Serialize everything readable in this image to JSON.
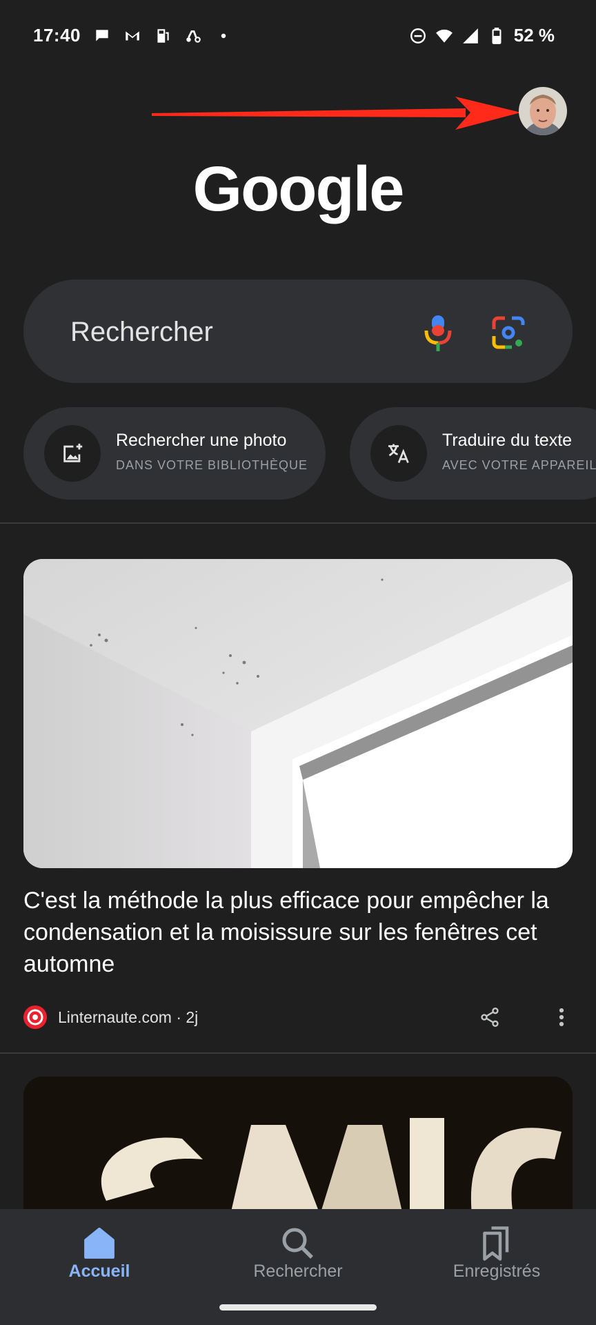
{
  "status_bar": {
    "time": "17:40",
    "battery": "52 %",
    "left_icons": [
      "chat-bubble-icon",
      "gmail-icon",
      "fuel-icon",
      "scooter-icon",
      "dot-icon"
    ],
    "right_icons": [
      "do-not-disturb-icon",
      "wifi-icon",
      "signal-icon",
      "battery-icon"
    ]
  },
  "header": {
    "logo": "Google",
    "avatar_icon": "profile-avatar-icon"
  },
  "search": {
    "placeholder": "Rechercher",
    "mic_icon": "mic-icon",
    "lens_icon": "google-lens-icon"
  },
  "chips": [
    {
      "title": "Rechercher une photo",
      "subtitle": "DANS VOTRE BIBLIOTHÈQUE",
      "icon": "add-photo-icon"
    },
    {
      "title": "Traduire du texte",
      "subtitle": "AVEC VOTRE APPAREIL",
      "icon": "translate-icon"
    }
  ],
  "article": {
    "title": "C'est la méthode la plus efficace pour empêcher la condensation et la moisissure sur les fenêtres cet automne",
    "source": "Linternaute.com · 2j"
  },
  "nav": {
    "items": [
      {
        "label": "Accueil",
        "icon": "home-icon",
        "active": true
      },
      {
        "label": "Rechercher",
        "icon": "search-icon",
        "active": false
      },
      {
        "label": "Enregistrés",
        "icon": "saved-bookmarks-icon",
        "active": false
      }
    ]
  },
  "colors": {
    "background": "#1f1f1f",
    "surface": "#303134",
    "accent": "#8ab4f8",
    "arrow": "#ff2a1a",
    "source_logo": "#e8222e"
  }
}
